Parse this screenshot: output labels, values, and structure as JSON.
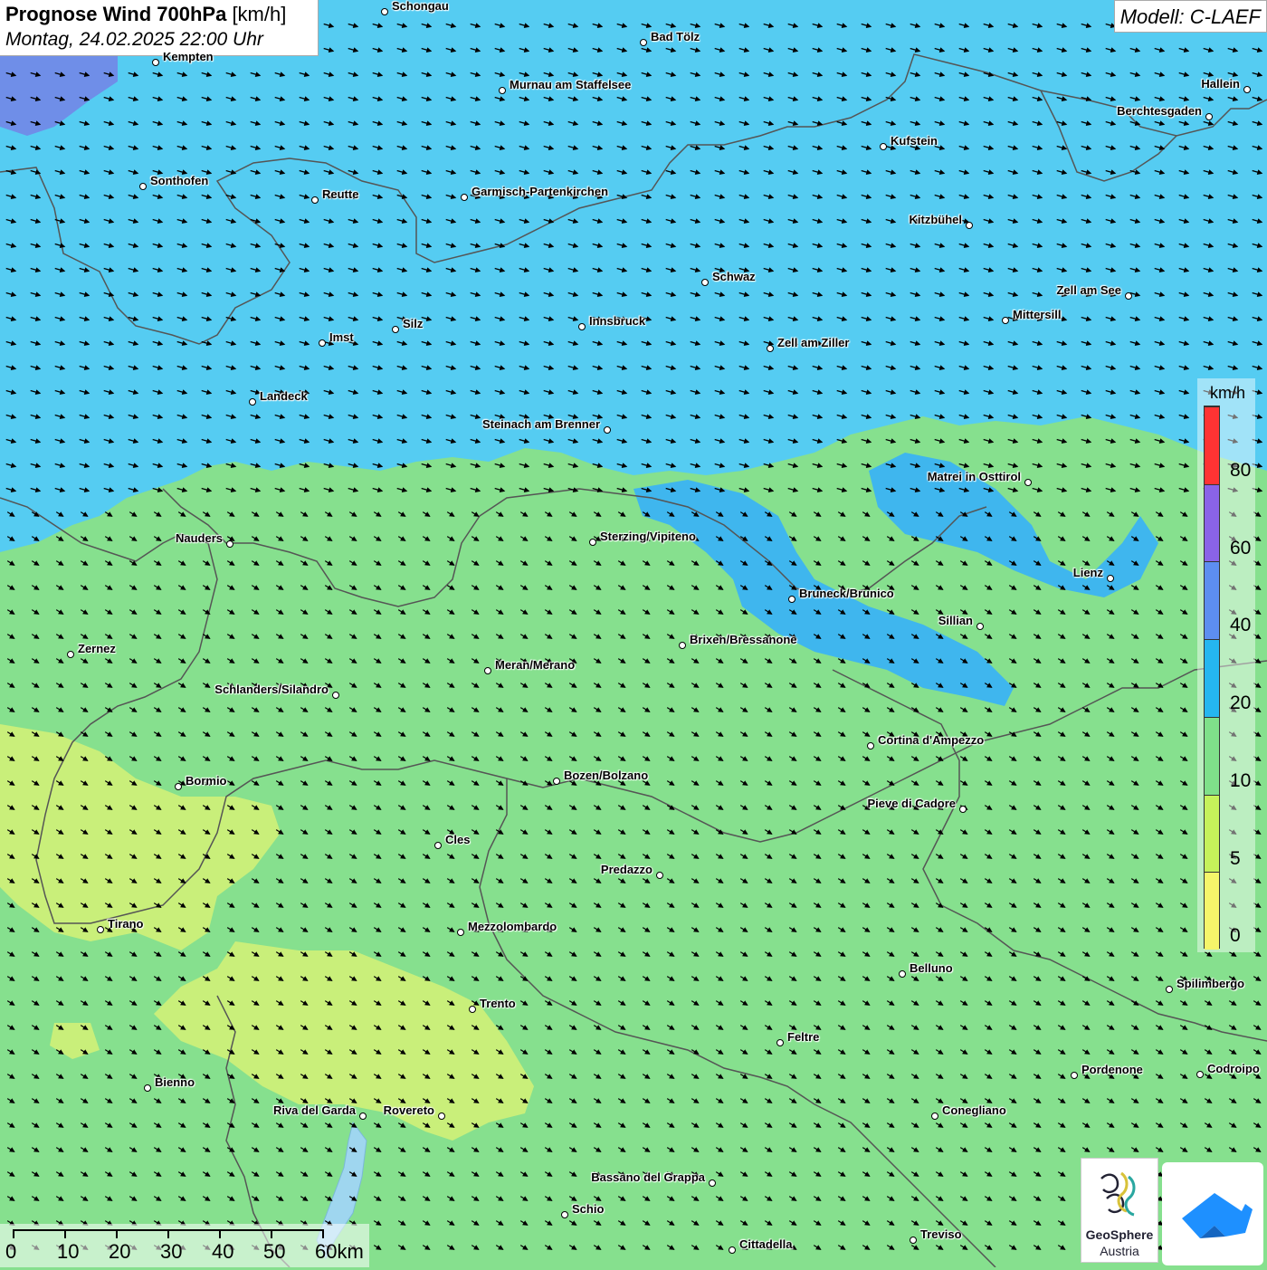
{
  "title": {
    "main": "Prognose Wind 700hPa",
    "unit": "[km/h]",
    "datetime": "Montag, 24.02.2025 22:00 Uhr"
  },
  "model": "Modell: C-LAEF",
  "legend": {
    "unit": "km/h",
    "labels": [
      "80",
      "60",
      "40",
      "20",
      "10",
      "5",
      "0"
    ],
    "colors": [
      "#ff3333",
      "#8a63e8",
      "#5d8ef0",
      "#25b6f0",
      "#7fe08a",
      "#c6f25a",
      "#f5f56a"
    ]
  },
  "scalebar": {
    "labels": [
      "0",
      "10",
      "20",
      "30",
      "40",
      "50",
      "60km"
    ]
  },
  "logos": {
    "geosphere_line1": "GeoSphere",
    "geosphere_line2": "Austria"
  },
  "cities": [
    {
      "name": "Schongau",
      "side": "right"
    },
    {
      "name": "Bad Tölz",
      "side": "right"
    },
    {
      "name": "Kempten",
      "side": "right"
    },
    {
      "name": "Murnau am Staffelsee",
      "side": "right"
    },
    {
      "name": "Hallein",
      "side": "left"
    },
    {
      "name": "Berchtesgaden",
      "side": "left"
    },
    {
      "name": "Kufstein",
      "side": "right"
    },
    {
      "name": "Sonthofen",
      "side": "right"
    },
    {
      "name": "Reutte",
      "side": "right"
    },
    {
      "name": "Garmisch-Partenkirchen",
      "side": "right"
    },
    {
      "name": "Kitzbühel",
      "side": "left"
    },
    {
      "name": "Schwaz",
      "side": "right"
    },
    {
      "name": "Zell am See",
      "side": "left"
    },
    {
      "name": "Mittersill",
      "side": "right"
    },
    {
      "name": "Innsbruck",
      "side": "right"
    },
    {
      "name": "Silz",
      "side": "right"
    },
    {
      "name": "Imst",
      "side": "right"
    },
    {
      "name": "Zell am Ziller",
      "side": "right"
    },
    {
      "name": "Landeck",
      "side": "right"
    },
    {
      "name": "Steinach am Brenner",
      "side": "left"
    },
    {
      "name": "Matrei in Osttirol",
      "side": "left"
    },
    {
      "name": "Nauders",
      "side": "left"
    },
    {
      "name": "Sterzing/Vipiteno",
      "side": "right"
    },
    {
      "name": "Lienz",
      "side": "left"
    },
    {
      "name": "Bruneck/Brunico",
      "side": "right"
    },
    {
      "name": "Sillian",
      "side": "left"
    },
    {
      "name": "Zernez",
      "side": "right"
    },
    {
      "name": "Brixen/Bressanone",
      "side": "right"
    },
    {
      "name": "Meran/Merano",
      "side": "right"
    },
    {
      "name": "Schlanders/Silandro",
      "side": "left"
    },
    {
      "name": "Cortina d'Ampezzo",
      "side": "right"
    },
    {
      "name": "Bozen/Bolzano",
      "side": "right"
    },
    {
      "name": "Bormio",
      "side": "right"
    },
    {
      "name": "Pieve di Cadore",
      "side": "left"
    },
    {
      "name": "Cles",
      "side": "right"
    },
    {
      "name": "Predazzo",
      "side": "left"
    },
    {
      "name": "Tirano",
      "side": "right"
    },
    {
      "name": "Mezzolombardo",
      "side": "right"
    },
    {
      "name": "Belluno",
      "side": "right"
    },
    {
      "name": "Spilimbergo",
      "side": "right"
    },
    {
      "name": "Trento",
      "side": "right"
    },
    {
      "name": "Feltre",
      "side": "right"
    },
    {
      "name": "Pordenone",
      "side": "right"
    },
    {
      "name": "Codroipo",
      "side": "right"
    },
    {
      "name": "Bienno",
      "side": "right"
    },
    {
      "name": "Riva del Garda",
      "side": "left"
    },
    {
      "name": "Rovereto",
      "side": "left"
    },
    {
      "name": "Conegliano",
      "side": "right"
    },
    {
      "name": "Bassano del Grappa",
      "side": "left"
    },
    {
      "name": "Schio",
      "side": "right"
    },
    {
      "name": "Treviso",
      "side": "right"
    },
    {
      "name": "Cittadella",
      "side": "right"
    }
  ]
}
